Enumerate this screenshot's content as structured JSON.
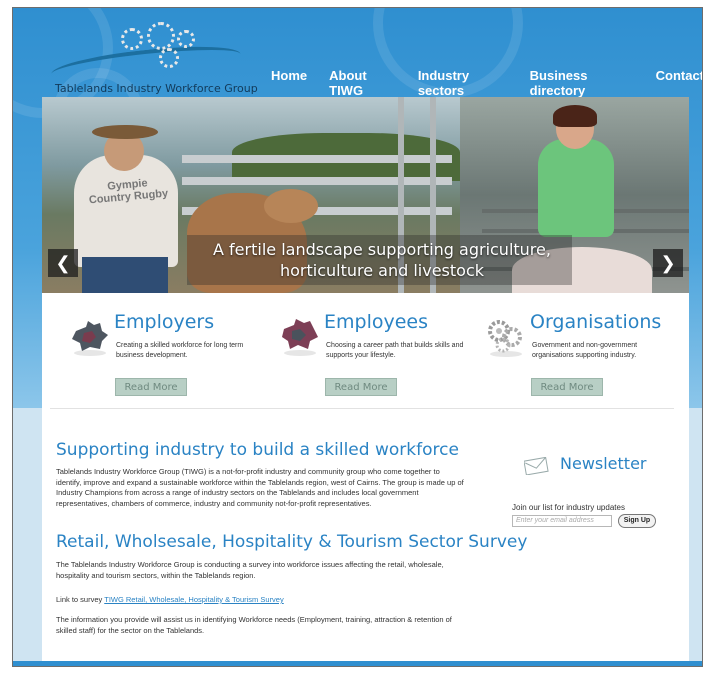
{
  "brand": {
    "name": "Tablelands Industry Workforce Group",
    "colors": {
      "primary": "#2a83c4",
      "header": "#2f8fd0",
      "button": "#b8cfc5"
    }
  },
  "nav": {
    "items": [
      {
        "label": "Home"
      },
      {
        "label": "About TIWG"
      },
      {
        "label": "Industry sectors"
      },
      {
        "label": "Business directory"
      },
      {
        "label": "Contact"
      }
    ]
  },
  "slider": {
    "caption": "A fertile landscape supporting agriculture, horticulture and livestock",
    "shirt_text": "Gympie Country Rugby",
    "prev_icon": "chevron-left-icon",
    "next_icon": "chevron-right-icon"
  },
  "features": [
    {
      "title": "Employers",
      "description": "Creating a skilled workforce for long term business development.",
      "button": "Read More",
      "icon": "puzzle-icon"
    },
    {
      "title": "Employees",
      "description": "Choosing a career path that builds skills and supports your lifestyle.",
      "button": "Read More",
      "icon": "puzzle-icon"
    },
    {
      "title": "Organisations",
      "description": "Government and non-government organisations supporting industry.",
      "button": "Read More",
      "icon": "gears-icon"
    }
  ],
  "main": {
    "heading1": "Supporting industry to build a skilled workforce",
    "para1": "Tablelands Industry Workforce Group (TIWG) is a not-for-profit industry and community group who come together to identify, improve and expand a sustainable workforce within the Tablelands region, west of Cairns. The group is made up of Industry Champions from across a range of industry sectors on the Tablelands and includes local government representatives, chambers of commerce, industry and community not-for-profit representatives.",
    "heading2": "Retail, Wholsesale, Hospitality & Tourism Sector Survey",
    "para2": "The Tablelands Industry Workforce Group is conducting a survey  into workforce issues affecting the retail, wholesale, hospitality and tourism sectors, within the Tablelands region.",
    "link_prefix": "Link to survey ",
    "link_text": "TIWG Retail, Wholesale, Hospitality & Tourism Survey",
    "para3": "The information you provide will assist us in identifying Workforce needs (Employment, training, attraction & retention of skilled staff) for the sector on the Tablelands."
  },
  "newsletter": {
    "title": "Newsletter",
    "note": "Join our list for industry updates",
    "placeholder": "Enter your email address",
    "button": "Sign Up"
  }
}
